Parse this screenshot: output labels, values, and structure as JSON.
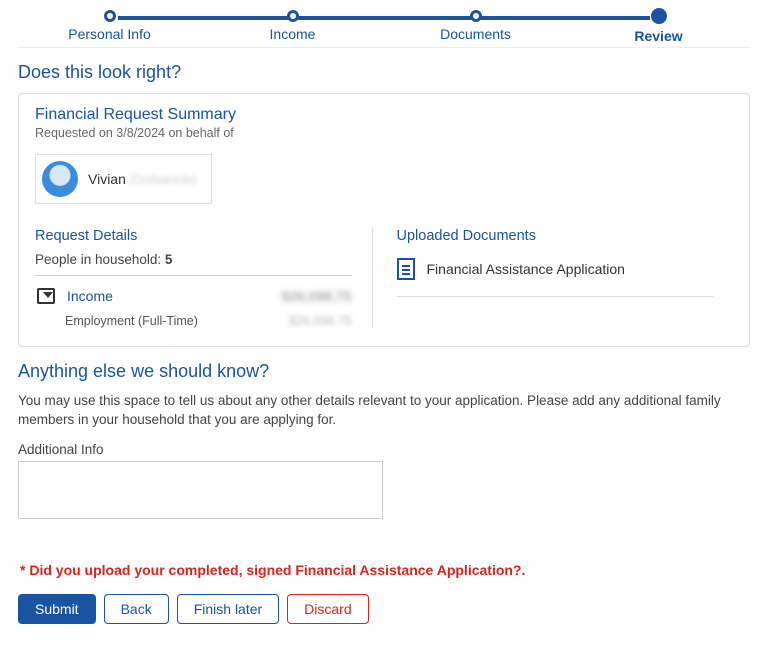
{
  "progress": {
    "steps": [
      {
        "label": "Personal Info",
        "active": false
      },
      {
        "label": "Income",
        "active": false
      },
      {
        "label": "Documents",
        "active": false
      },
      {
        "label": "Review",
        "active": true
      }
    ]
  },
  "review": {
    "title": "Does this look right?",
    "summary_title": "Financial Request Summary",
    "requested_line": "Requested on 3/8/2024 on behalf of",
    "person": {
      "first": "Vivian",
      "last": "Zzzbancks"
    },
    "request_details": {
      "title": "Request Details",
      "household_label": "People in household:",
      "household_count": "5",
      "income_label": "Income",
      "income_amount": "$26,098.75",
      "income_sub_label": "Employment (Full-Time)",
      "income_sub_amount": "$26,098.75"
    },
    "documents": {
      "title": "Uploaded Documents",
      "items": [
        "Financial Assistance Application"
      ]
    }
  },
  "anything_else": {
    "title": "Anything else we should know?",
    "help": "You may use this space to tell us about any other details relevant to your application. Please add any additional family members in your household that you are applying for.",
    "field_label": "Additional Info",
    "value": ""
  },
  "error": "* Did you upload your completed, signed Financial Assistance Application?.",
  "buttons": {
    "submit": "Submit",
    "back": "Back",
    "finish_later": "Finish later",
    "discard": "Discard"
  }
}
